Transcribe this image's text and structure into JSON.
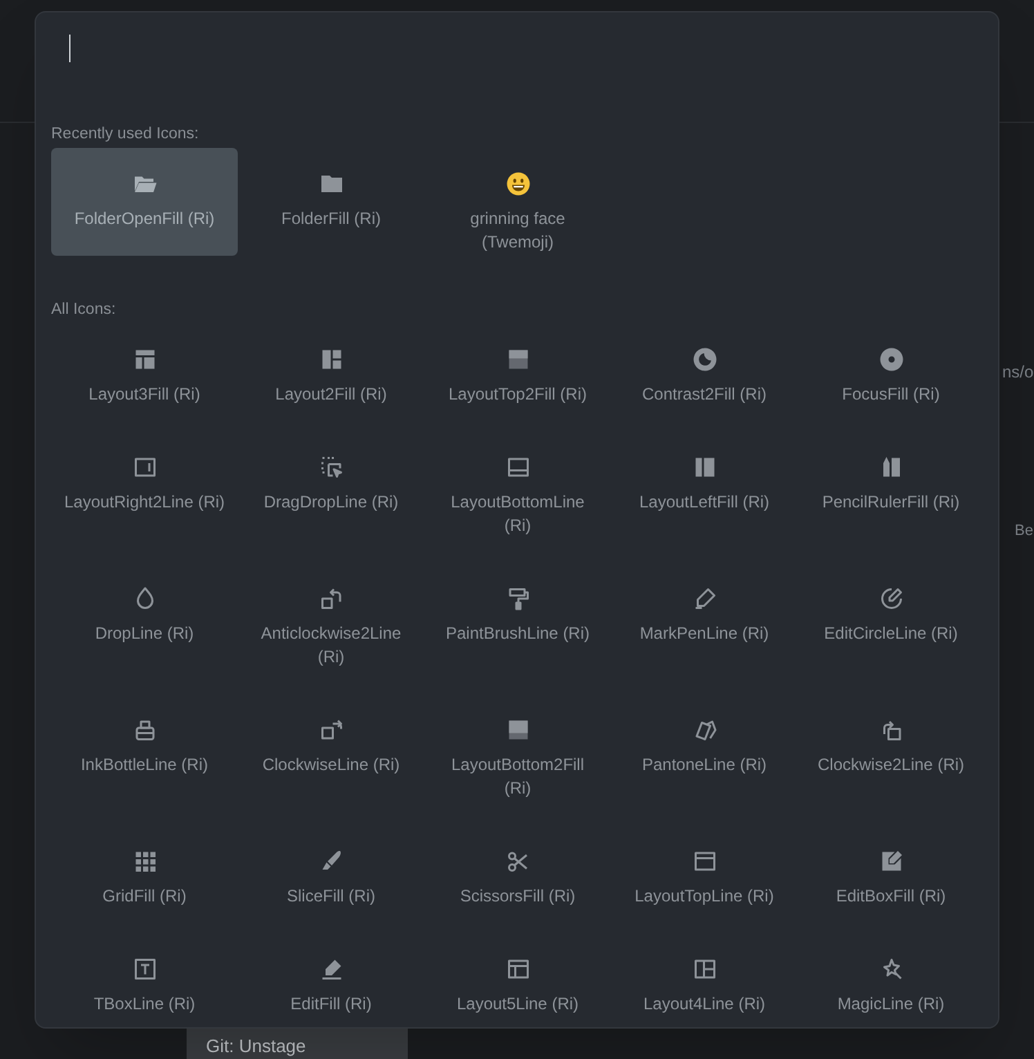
{
  "search": {
    "focused": true
  },
  "recent": {
    "heading": "Recently used Icons:",
    "items": [
      {
        "label": "FolderOpenFill (Ri)",
        "selected": true
      },
      {
        "label": "FolderFill (Ri)",
        "selected": false
      },
      {
        "label": "grinning face (Twemoji)",
        "selected": false
      }
    ]
  },
  "all": {
    "heading": "All Icons:",
    "items": [
      {
        "label": "Layout3Fill (Ri)"
      },
      {
        "label": "Layout2Fill (Ri)"
      },
      {
        "label": "LayoutTop2Fill (Ri)"
      },
      {
        "label": "Contrast2Fill (Ri)"
      },
      {
        "label": "FocusFill (Ri)"
      },
      {
        "label": "LayoutRight2Line (Ri)"
      },
      {
        "label": "DragDropLine (Ri)"
      },
      {
        "label": "LayoutBottomLine (Ri)"
      },
      {
        "label": "LayoutLeftFill (Ri)"
      },
      {
        "label": "PencilRulerFill (Ri)"
      },
      {
        "label": "DropLine (Ri)"
      },
      {
        "label": "Anticlockwise2Line (Ri)"
      },
      {
        "label": "PaintBrushLine (Ri)"
      },
      {
        "label": "MarkPenLine (Ri)"
      },
      {
        "label": "EditCircleLine (Ri)"
      },
      {
        "label": "InkBottleLine (Ri)"
      },
      {
        "label": "ClockwiseLine (Ri)"
      },
      {
        "label": "LayoutBottom2Fill (Ri)"
      },
      {
        "label": "PantoneLine (Ri)"
      },
      {
        "label": "Clockwise2Line (Ri)"
      },
      {
        "label": "GridFill (Ri)"
      },
      {
        "label": "SliceFill (Ri)"
      },
      {
        "label": "ScissorsFill (Ri)"
      },
      {
        "label": "LayoutTopLine (Ri)"
      },
      {
        "label": "EditBoxFill (Ri)"
      },
      {
        "label": "TBoxLine (Ri)"
      },
      {
        "label": "EditFill (Ri)"
      },
      {
        "label": "Layout5Line (Ri)"
      },
      {
        "label": "Layout4Line (Ri)"
      },
      {
        "label": "MagicLine (Ri)"
      }
    ]
  },
  "background": {
    "status_item": "Git: Unstage",
    "fragments": [
      "ns/o",
      "Be"
    ]
  }
}
